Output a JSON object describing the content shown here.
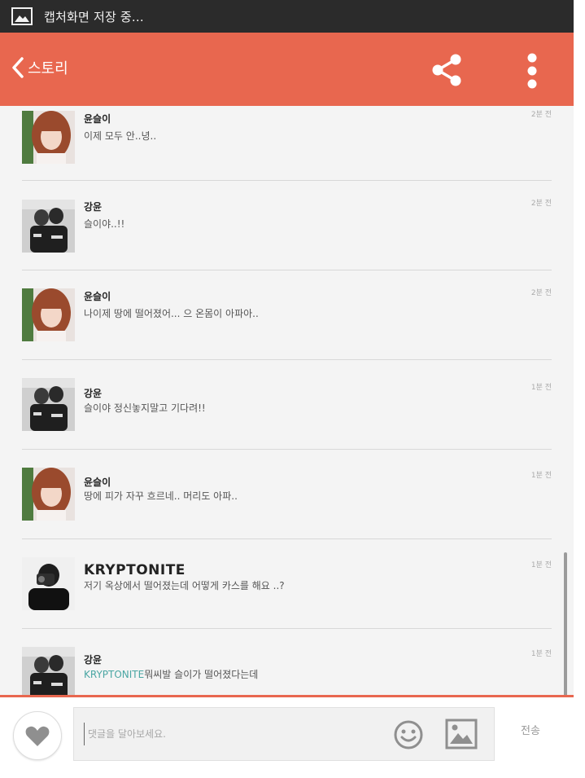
{
  "statusbar": {
    "icon": "image-icon",
    "text": "캡처화면 저장 중..."
  },
  "appbar": {
    "back_label": "스토리",
    "icons": [
      "chevron-left-icon",
      "share-icon",
      "more-vertical-icon"
    ],
    "color": "#e8674f"
  },
  "comments": [
    {
      "author": "윤슬이",
      "message": "이제 모두 안..녕..",
      "time": "2분 전",
      "avatar": "avatar-girl"
    },
    {
      "author": "강윤",
      "message": "슬이야..!!",
      "time": "2분 전",
      "avatar": "avatar-couple"
    },
    {
      "author": "윤슬이",
      "message": "나이제 땅에 떨어졌어... 으 온몸이 아파아..",
      "time": "2분 전",
      "avatar": "avatar-girl"
    },
    {
      "author": "강윤",
      "message": "슬이야 정신놓지말고 기다려!!",
      "time": "1분 전",
      "avatar": "avatar-couple"
    },
    {
      "author": "윤슬이",
      "message": "땅에 피가 자꾸 흐르네.. 머리도 아파..",
      "time": "1분 전",
      "avatar": "avatar-girl"
    },
    {
      "author": "KRYPTONITE",
      "message": "저기 옥상에서 떨어졌는데 어떻게 카스를 해요 ..?",
      "time": "1분 전",
      "avatar": "avatar-photographer"
    },
    {
      "author": "강윤",
      "mention": "KRYPTONITE",
      "message": "뭐씨발 슬이가 떨어졌다는데",
      "time": "1분 전",
      "avatar": "avatar-couple"
    }
  ],
  "composer": {
    "placeholder": "댓글을 달아보세요.",
    "send_label": "전송",
    "icons": [
      "heart-icon",
      "smiley-icon",
      "image-icon"
    ]
  }
}
